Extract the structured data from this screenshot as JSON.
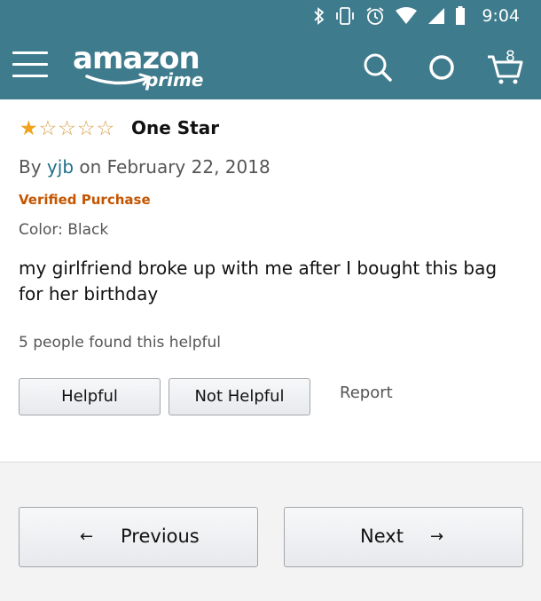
{
  "status_bar": {
    "time": "9:04",
    "icons": [
      "bluetooth-icon",
      "vibrate-icon",
      "alarm-icon",
      "wifi-icon",
      "signal-icon",
      "battery-icon"
    ]
  },
  "header": {
    "logo_text": "amazon",
    "logo_sub": "prime",
    "cart_count": "8",
    "bg_color": "#3e7b8c"
  },
  "review": {
    "rating": 1,
    "max_rating": 5,
    "title": "One Star",
    "by_prefix": "By",
    "author": "yjb",
    "date_text": "on February 22, 2018",
    "verified": "Verified Purchase",
    "variant": "Color: Black",
    "body": "my girlfriend broke up with me after I bought this bag for her birthday",
    "helpful_count_text": "5 people found this helpful",
    "helpful_label": "Helpful",
    "not_helpful_label": "Not Helpful",
    "report_label": "Report"
  },
  "pagination": {
    "previous_label": "Previous",
    "next_label": "Next",
    "prev_arrow": "←",
    "next_arrow": "→"
  },
  "colors": {
    "star": "#f0a31b",
    "verified": "#c45500",
    "link": "#1f6f8b"
  }
}
